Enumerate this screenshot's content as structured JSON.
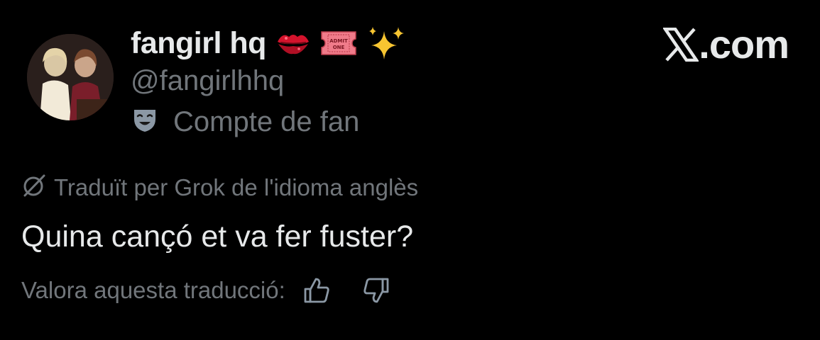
{
  "profile": {
    "display_name": "fangirl hq",
    "handle": "@fangirlhhq",
    "emojis": [
      "kiss-mark",
      "admit-one-ticket",
      "sparkles"
    ],
    "ticket_text": "ADMIT ONE",
    "label": "Compte de fan",
    "label_icon": "performing-arts-mask"
  },
  "brand": {
    "site": ".com",
    "logo": "x-logo"
  },
  "translation": {
    "notice": "Traduït per Grok de l'idioma anglès",
    "text": "Quina cançó et va fer fuster?",
    "rate_label": "Valora aquesta traducció:"
  },
  "colors": {
    "background": "#000000",
    "primary_text": "#e7e9ea",
    "secondary_text": "#71767b"
  }
}
